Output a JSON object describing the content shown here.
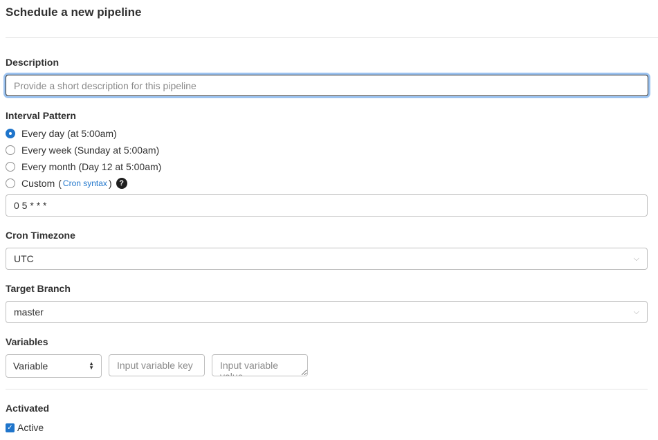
{
  "page": {
    "title": "Schedule a new pipeline"
  },
  "description": {
    "label": "Description",
    "placeholder": "Provide a short description for this pipeline",
    "value": ""
  },
  "interval": {
    "label": "Interval Pattern",
    "options": [
      {
        "label": "Every day (at 5:00am)",
        "checked": true
      },
      {
        "label": "Every week (Sunday at 5:00am)",
        "checked": false
      },
      {
        "label": "Every month (Day 12 at 5:00am)",
        "checked": false
      },
      {
        "label": "Custom",
        "checked": false
      }
    ],
    "custom_paren_open": "(",
    "custom_link": "Cron syntax",
    "custom_paren_close": ")",
    "help_icon": "question-circle-icon",
    "help_glyph": "?",
    "cron_value": "0 5 * * *"
  },
  "timezone": {
    "label": "Cron Timezone",
    "value": "UTC",
    "icon": "chevron-down-icon",
    "chevron": "⌵"
  },
  "branch": {
    "label": "Target Branch",
    "value": "master",
    "icon": "chevron-down-icon",
    "chevron": "⌵"
  },
  "variables": {
    "label": "Variables",
    "type_value": "Variable",
    "type_icon": "updown-icon",
    "type_up": "▲",
    "type_down": "▼",
    "key_placeholder": "Input variable key",
    "value_placeholder": "Input variable value"
  },
  "activated": {
    "label": "Activated",
    "checkbox_label": "Active",
    "checked": true,
    "check_glyph": "✓"
  },
  "colors": {
    "accent": "#1f75cb",
    "focus_ring": "#9cc3f0",
    "border": "#bfbfbf",
    "text": "#303030"
  }
}
